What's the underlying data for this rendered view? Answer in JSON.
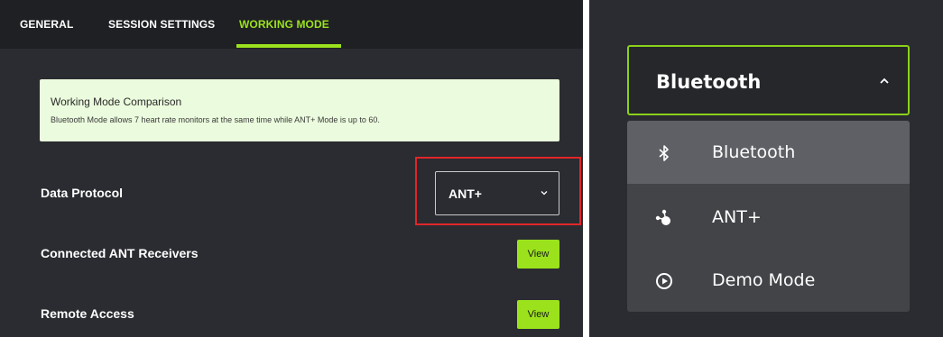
{
  "tabs": [
    {
      "label": "GENERAL"
    },
    {
      "label": "SESSION SETTINGS"
    },
    {
      "label": "WORKING MODE",
      "active": true
    }
  ],
  "info": {
    "title": "Working Mode Comparison",
    "text": "Bluetooth Mode allows 7 heart rate monitors at the same time while ANT+ Mode is up to 60."
  },
  "settings": {
    "data_protocol": {
      "label": "Data Protocol",
      "value": "ANT+"
    },
    "connected_receivers": {
      "label": "Connected ANT Receivers",
      "button": "View"
    },
    "remote_access": {
      "label": "Remote Access",
      "button": "View"
    }
  },
  "dropdown": {
    "selected": "Bluetooth",
    "options": [
      {
        "label": "Bluetooth",
        "icon": "bluetooth-icon",
        "highlighted": true
      },
      {
        "label": "ANT+",
        "icon": "ant-plus-icon"
      },
      {
        "label": "Demo Mode",
        "icon": "play-circle-icon"
      }
    ]
  },
  "colors": {
    "accent": "#9be21d",
    "panel_bg": "#2b2c31",
    "tabbar_bg": "#1f2023",
    "info_bg": "#ebfbdd",
    "highlight_border": "#e0262a"
  }
}
